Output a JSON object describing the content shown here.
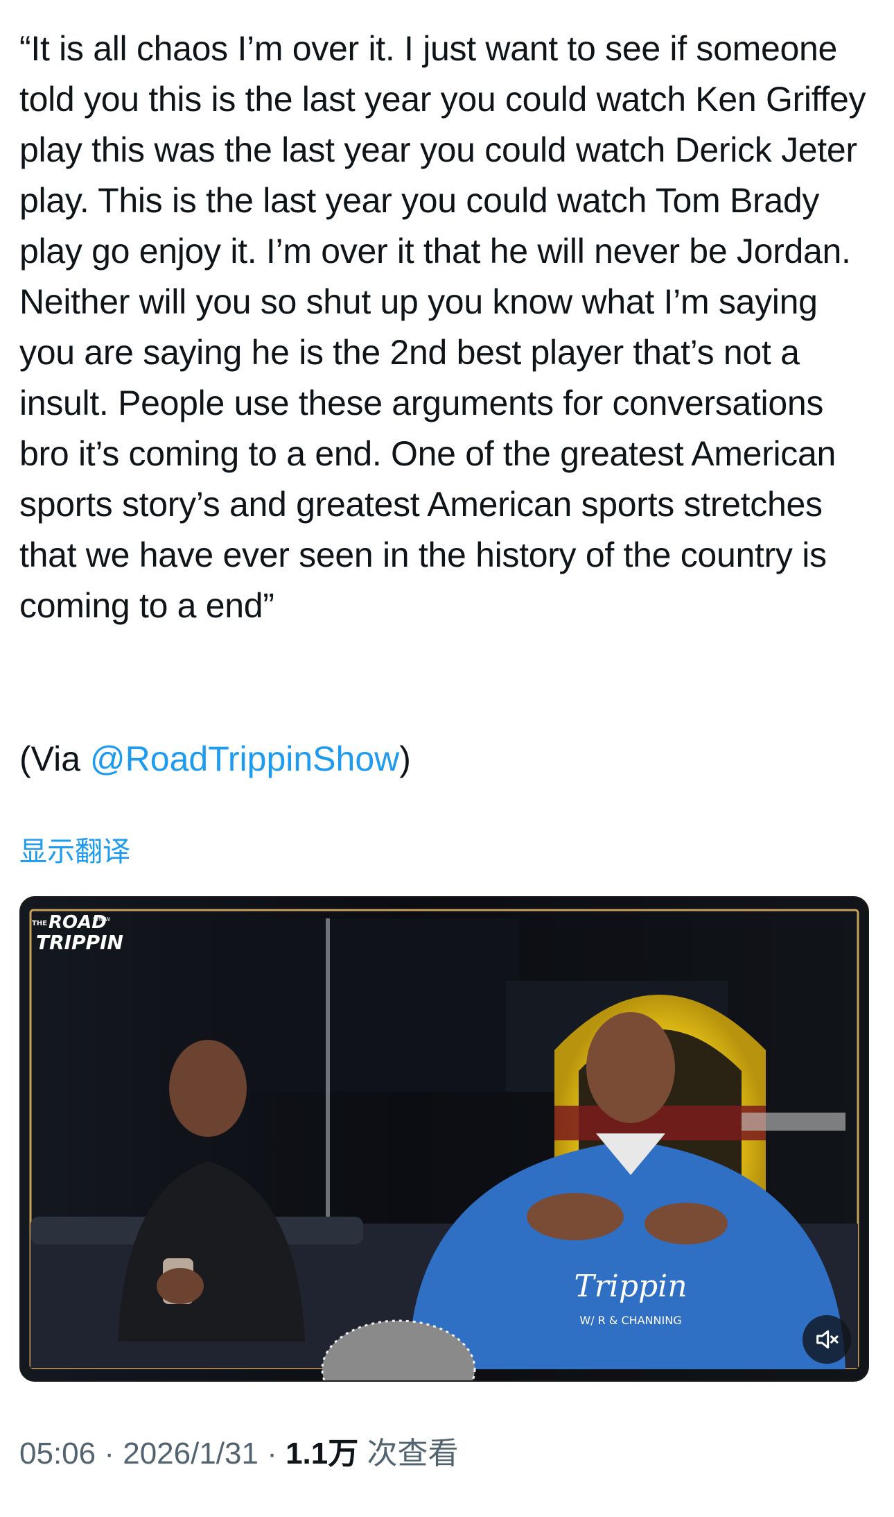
{
  "tweet": {
    "text": "“It is all chaos I’m over it. I just want to see if someone told you this is the last year you could watch Ken Griffey play this was the last year you could watch Derick Jeter play. This is the last year you could watch Tom Brady play go enjoy it. I’m over it that he will never be Jordan. Neither will you so shut up you know what I’m saying you are saying he is the 2nd best player that’s not a insult. People use these arguments for conversations bro it’s coming to a end. One of the greatest American sports story’s and greatest American sports stretches that we have ever seen in the history of the country is coming to a end”",
    "via_prefix": "(Via ",
    "via_handle": "@RoadTrippinShow",
    "via_suffix": ")"
  },
  "translate_label": "显示翻译",
  "video": {
    "logo_line1": "ROAD",
    "logo_line2": "TRIPPIN",
    "logo_small": "THE",
    "logo_show": "SHOW",
    "hoodie_text": "Trippin",
    "hoodie_sub": "W/ R & CHANNING",
    "mute_icon": "volume-muted-icon",
    "colors": {
      "hoodie": "#2f6fc4",
      "jukebox": "#f4d21a",
      "backdrop": "#0d1016",
      "frame": "#c8a05a"
    }
  },
  "meta": {
    "time": "05:06",
    "sep1": " · ",
    "date": "2026/1/31",
    "sep2": " · ",
    "views_count": "1.1万",
    "views_label": " 次查看"
  }
}
